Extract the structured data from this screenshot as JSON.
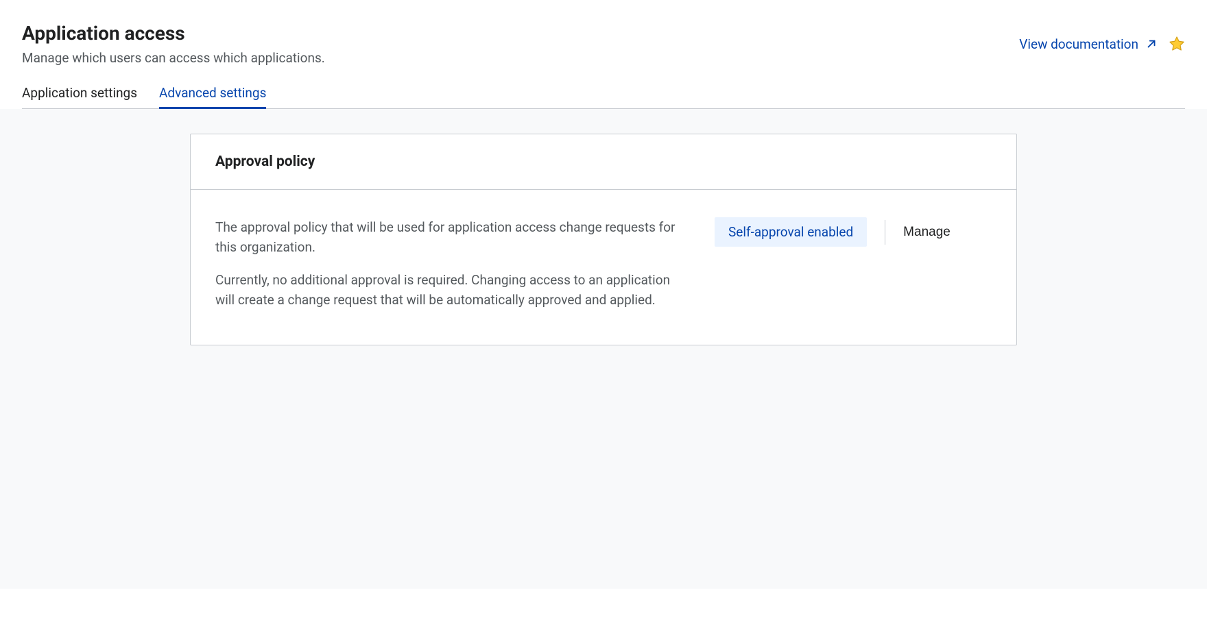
{
  "header": {
    "title": "Application access",
    "subtitle": "Manage which users can access which applications.",
    "doc_link_label": "View documentation"
  },
  "tabs": {
    "items": [
      {
        "label": "Application settings",
        "active": false
      },
      {
        "label": "Advanced settings",
        "active": true
      }
    ]
  },
  "card": {
    "title": "Approval policy",
    "paragraph1": "The approval policy that will be used for application access change requests for this organization.",
    "paragraph2": "Currently, no additional approval is required. Changing access to an application will create a change request that will be automatically approved and applied.",
    "status_label": "Self-approval enabled",
    "manage_label": "Manage"
  }
}
